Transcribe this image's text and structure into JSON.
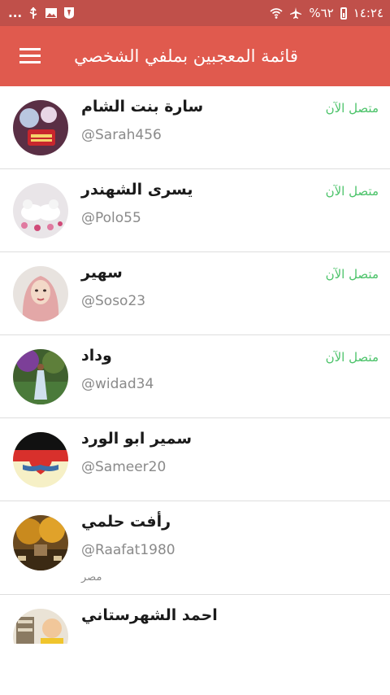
{
  "status_bar": {
    "time": "١٤:٢٤",
    "battery_text": "%٦٢",
    "dots": "..."
  },
  "app_bar": {
    "title": "قائمة المعجبين بملفي الشخصي",
    "menu_icon": "hamburger-menu-icon"
  },
  "colors": {
    "status_bar": "#c0504a",
    "app_bar": "#e05a4e",
    "online": "#4cc36a"
  },
  "users": [
    {
      "name": "سارة بنت الشام",
      "handle": "@Sarah456",
      "status": "متصل الآن",
      "country": ""
    },
    {
      "name": "يسرى الشهندر",
      "handle": "@Polo55",
      "status": "متصل الآن",
      "country": ""
    },
    {
      "name": "سهير",
      "handle": "@Soso23",
      "status": "متصل الآن",
      "country": ""
    },
    {
      "name": "وداد",
      "handle": "@widad34",
      "status": "متصل الآن",
      "country": ""
    },
    {
      "name": "سمير ابو الورد",
      "handle": "@Sameer20",
      "status": "",
      "country": ""
    },
    {
      "name": "رأفت حلمي",
      "handle": "@Raafat1980",
      "status": "",
      "country": "مصر"
    },
    {
      "name": "احمد الشهرستاني",
      "handle": "",
      "status": "",
      "country": ""
    }
  ]
}
